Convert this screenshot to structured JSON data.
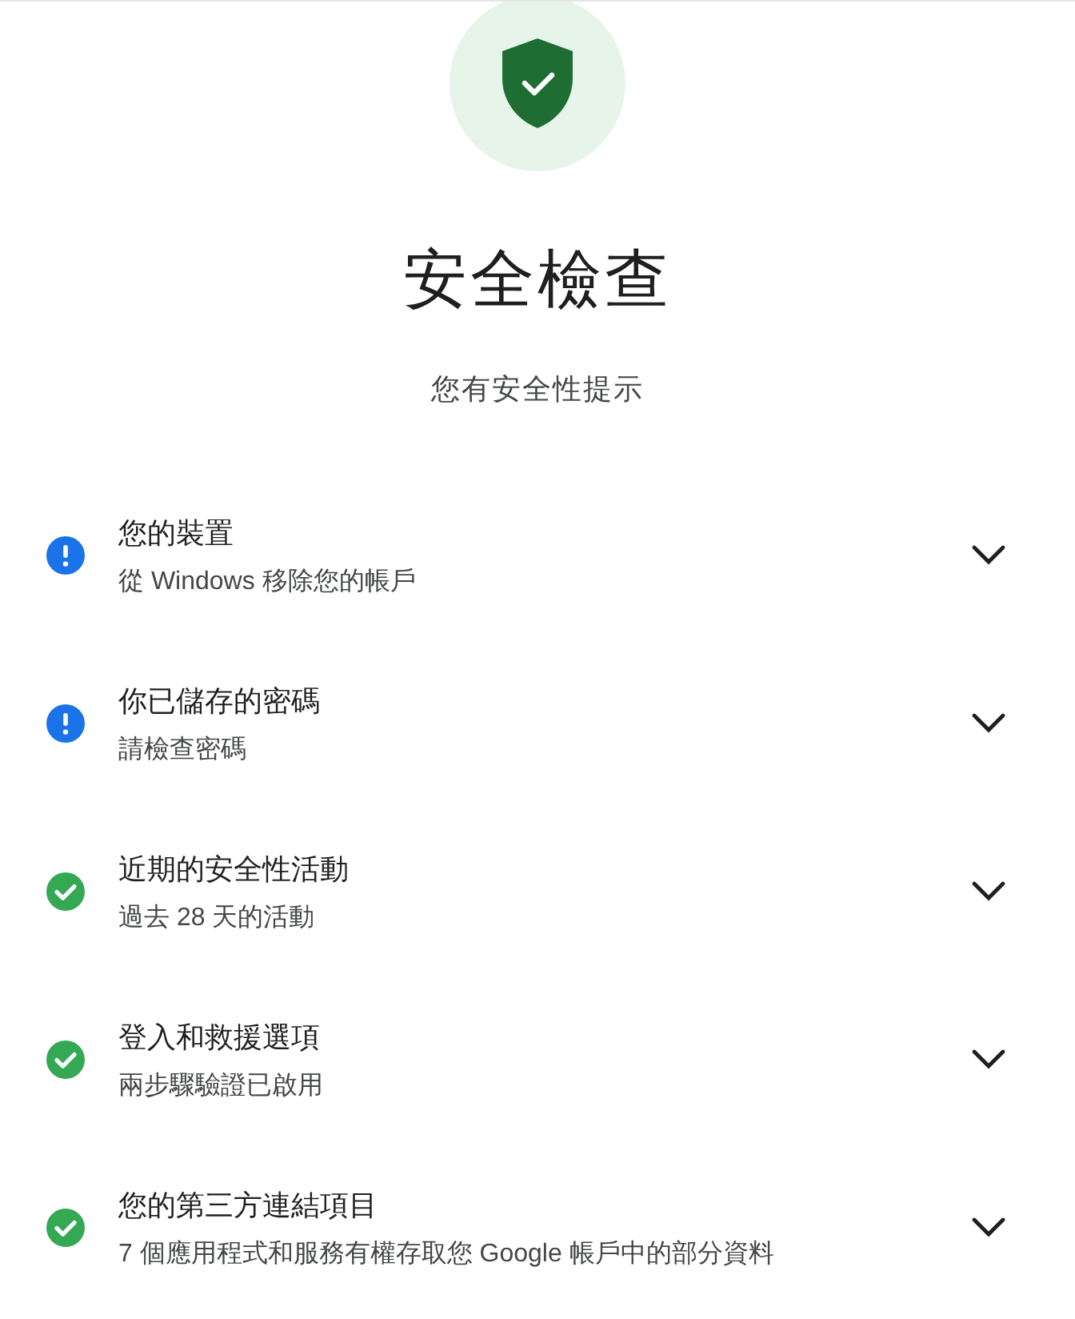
{
  "header": {
    "title": "安全檢查",
    "subtitle": "您有安全性提示"
  },
  "items": [
    {
      "kind": "warning",
      "title": "您的裝置",
      "detail": "從 Windows 移除您的帳戶",
      "expanded": false
    },
    {
      "kind": "warning",
      "title": "你已儲存的密碼",
      "detail": "請檢查密碼",
      "expanded": false
    },
    {
      "kind": "ok",
      "title": "近期的安全性活動",
      "detail": "過去 28 天的活動",
      "expanded": false
    },
    {
      "kind": "ok",
      "title": "登入和救援選項",
      "detail": "兩步驟驗證已啟用",
      "expanded": false
    },
    {
      "kind": "ok",
      "title": "您的第三方連結項目",
      "detail": "7 個應用程式和服務有權存取您 Google 帳戶中的部分資料",
      "expanded": false
    }
  ]
}
